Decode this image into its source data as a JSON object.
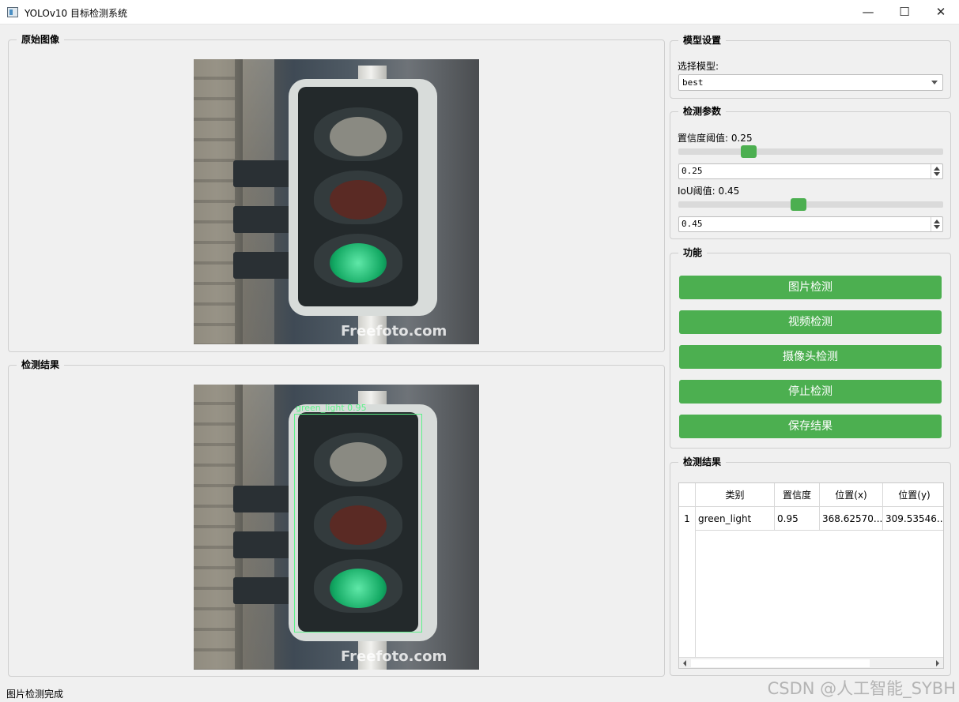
{
  "window": {
    "title": "YOLOv10 目标检测系统",
    "minimize": "—",
    "maximize": "☐",
    "close": "✕"
  },
  "original": {
    "title": "原始图像",
    "watermark": "Freefoto.com"
  },
  "result_view": {
    "title": "检测结果",
    "box_label": "green_light  0.95",
    "watermark": "Freefoto.com"
  },
  "model": {
    "title": "模型设置",
    "select_label": "选择模型:",
    "selected": "best"
  },
  "params": {
    "title": "检测参数",
    "conf_label": "置信度阈值: 0.25",
    "conf_value": "0.25",
    "conf_fraction": 0.25,
    "iou_label": "IoU阈值: 0.45",
    "iou_value": "0.45",
    "iou_fraction": 0.45
  },
  "functions": {
    "title": "功能",
    "buttons": [
      "图片检测",
      "视频检测",
      "摄像头检测",
      "停止检测",
      "保存结果"
    ],
    "button_color": "#4caf50"
  },
  "results": {
    "title": "检测结果",
    "columns": [
      "类别",
      "置信度",
      "位置(x)",
      "位置(y)"
    ],
    "rows": [
      {
        "num": "1",
        "cells": [
          "green_light",
          "0.95",
          "368.62570...",
          "309.53546..."
        ]
      }
    ]
  },
  "status": {
    "text": "图片检测完成"
  },
  "watermark": {
    "text": "CSDN @人工智能_SYBH"
  }
}
